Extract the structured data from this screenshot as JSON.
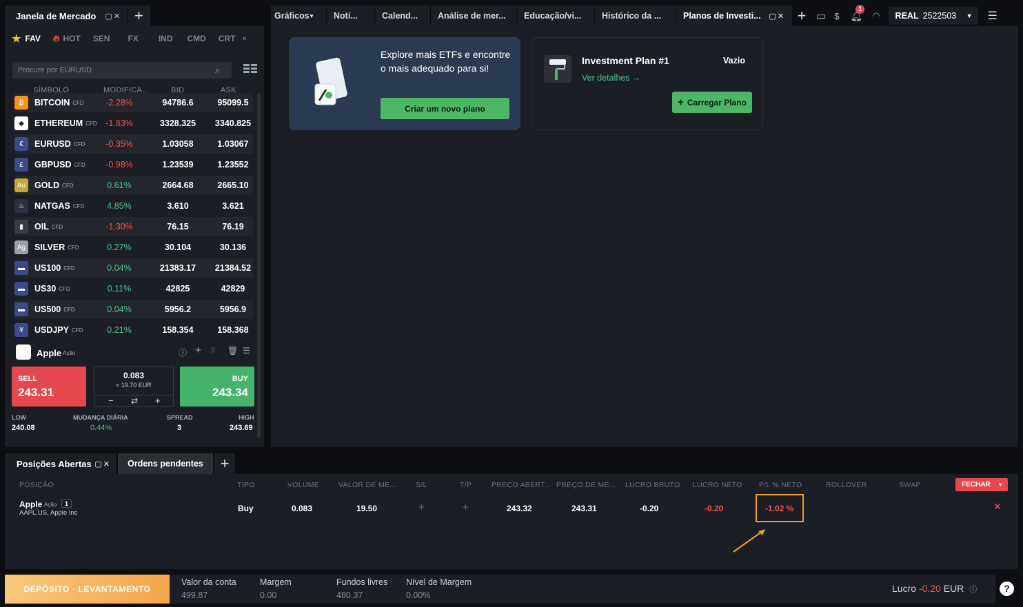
{
  "market": {
    "title": "Janela de Mercado",
    "categories": [
      "FAV",
      "HOT",
      "SEN",
      "FX",
      "IND",
      "CMD",
      "CRT"
    ],
    "search_placeholder": "Procure por EURUSD",
    "columns": [
      "SÍMBOLO",
      "MODIFICA...",
      "BID",
      "ASK"
    ],
    "cfd_tag": "CFD",
    "rows": [
      {
        "name": "BITCOIN",
        "change": "-2.28%",
        "bid": "94786.6",
        "ask": "95099.5",
        "neg": true,
        "color": "#f7931a",
        "glyph": "₿"
      },
      {
        "name": "ETHEREUM",
        "change": "-1.83%",
        "bid": "3328.325",
        "ask": "3340.825",
        "neg": true,
        "color": "#ffffff",
        "glyph": "◆"
      },
      {
        "name": "EURUSD",
        "change": "-0.35%",
        "bid": "1.03058",
        "ask": "1.03067",
        "neg": true,
        "color": "#3a4a8a",
        "glyph": "€"
      },
      {
        "name": "GBPUSD",
        "change": "-0.98%",
        "bid": "1.23539",
        "ask": "1.23552",
        "neg": true,
        "color": "#3a4a8a",
        "glyph": "£"
      },
      {
        "name": "GOLD",
        "change": "0.61%",
        "bid": "2664.68",
        "ask": "2665.10",
        "neg": false,
        "color": "#c9a63a",
        "glyph": "Au"
      },
      {
        "name": "NATGAS",
        "change": "4.85%",
        "bid": "3.610",
        "ask": "3.621",
        "neg": false,
        "color": "#2a3040",
        "glyph": "♨"
      },
      {
        "name": "OIL",
        "change": "-1.30%",
        "bid": "76.15",
        "ask": "76.19",
        "neg": true,
        "color": "#3a3d44",
        "glyph": "▮"
      },
      {
        "name": "SILVER",
        "change": "0.27%",
        "bid": "30.104",
        "ask": "30.136",
        "neg": false,
        "color": "#9aa0a8",
        "glyph": "Ag"
      },
      {
        "name": "US100",
        "change": "0.04%",
        "bid": "21383.17",
        "ask": "21384.52",
        "neg": false,
        "color": "#3a4a8a",
        "glyph": "▬"
      },
      {
        "name": "US30",
        "change": "0.11%",
        "bid": "42825",
        "ask": "42829",
        "neg": false,
        "color": "#3a4a8a",
        "glyph": "▬"
      },
      {
        "name": "US500",
        "change": "0.04%",
        "bid": "5956.2",
        "ask": "5956.9",
        "neg": false,
        "color": "#3a4a8a",
        "glyph": "▬"
      },
      {
        "name": "USDJPY",
        "change": "0.21%",
        "bid": "158.354",
        "ask": "158.368",
        "neg": false,
        "color": "#3a4a8a",
        "glyph": "¥"
      }
    ],
    "selected": {
      "name": "Apple",
      "type": "Ação",
      "sell_label": "SELL",
      "sell": "243.31",
      "buy_label": "BUY",
      "buy": "243.34",
      "volume": "0.083",
      "volume_eur": "≈ 19.70 EUR",
      "low_label": "LOW",
      "low": "240.08",
      "daily_label": "MUDANÇA DIÁRIA",
      "daily": "0.44%",
      "spread_label": "SPREAD",
      "spread": "3",
      "high_label": "HIGH",
      "high": "243.69"
    }
  },
  "toptabs": [
    "Gráficos",
    "Notí...",
    "Calend...",
    "Análise de mer...",
    "Educação/vi...",
    "Histórico da ...",
    "Planos de Investi..."
  ],
  "account": {
    "label": "REAL",
    "number": "2522503",
    "notif": "1"
  },
  "card1": {
    "text": "Explore mais ETFs e encontre o mais adequado para si!",
    "button": "Criar um novo plano"
  },
  "card2": {
    "title": "Investment Plan #1",
    "status": "Vazio",
    "link": "Ver detalhes →",
    "button": "Carregar Plano"
  },
  "bottom": {
    "tab1": "Posições Abertas",
    "tab2": "Ordens pendentes",
    "headers": [
      "POSIÇÃO",
      "TIPO",
      "VOLUME",
      "VALOR DE ME...",
      "S/L",
      "T/P",
      "PREÇO ABERT...",
      "PREÇO DE ME...",
      "LUCRO BRUTO",
      "LUCRO NETO",
      "P/L % NETO",
      "ROLLOVER",
      "SWAP"
    ],
    "close_btn": "FECHAR",
    "position": {
      "name": "Apple",
      "type_tag": "Ação",
      "count": "1",
      "sub": "AAPL.US, Apple Inc",
      "tipo": "Buy",
      "volume": "0.083",
      "valor": "19.50",
      "sl": "+",
      "tp": "+",
      "open": "243.32",
      "current": "243.31",
      "gross": "-0.20",
      "net": "-0.20",
      "pl": "-1.02 %"
    }
  },
  "footer": {
    "deposit": "DEPÓSITO · LEVANTAMENTO",
    "items": [
      {
        "label": "Valor da conta",
        "value": "499.87"
      },
      {
        "label": "Margem",
        "value": "0.00"
      },
      {
        "label": "Fundos livres",
        "value": "480.37"
      },
      {
        "label": "Nível de Margem",
        "value": "0.00%"
      }
    ],
    "profit_label": "Lucro",
    "profit_value": "-0.20",
    "currency": "EUR"
  }
}
